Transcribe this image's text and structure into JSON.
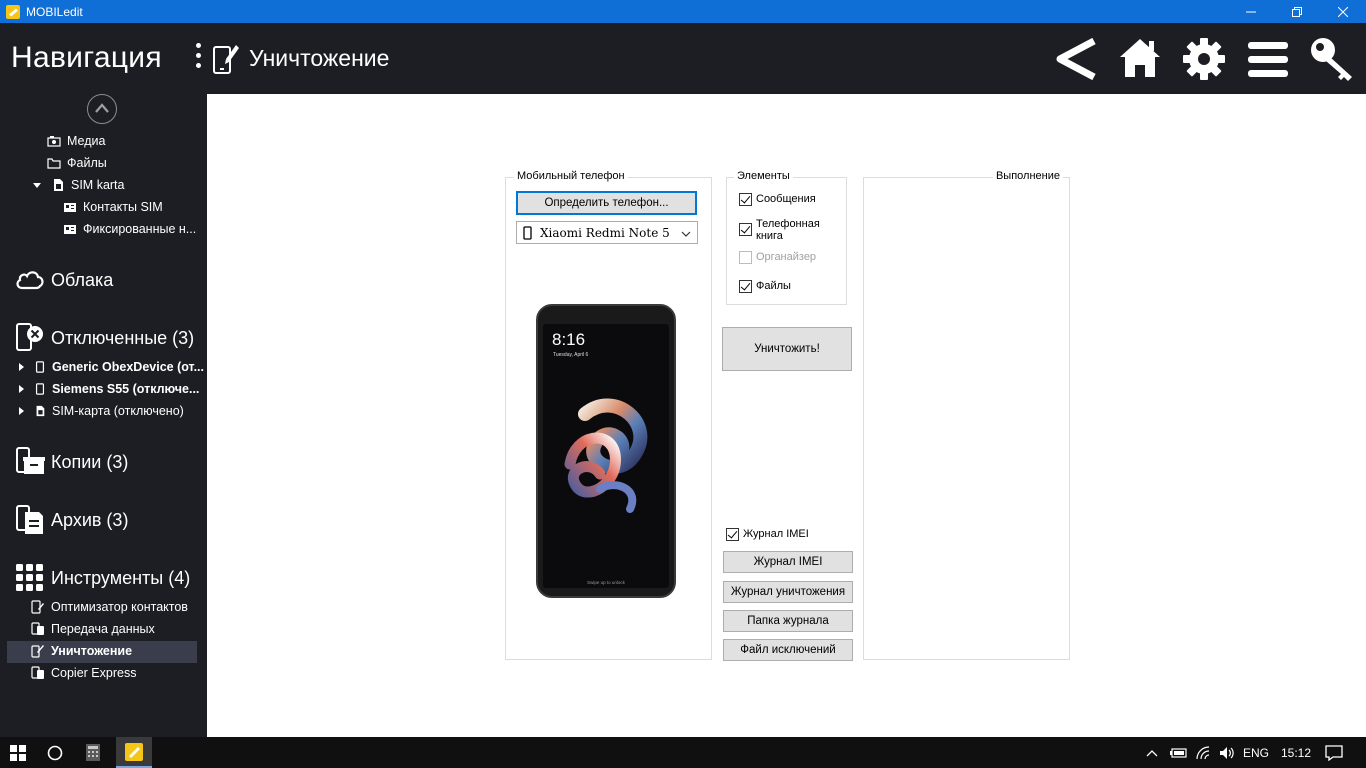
{
  "window": {
    "title": "MOBILedit",
    "controls": [
      "minimize",
      "restore",
      "close"
    ]
  },
  "header": {
    "nav_title": "Навигация",
    "page_title": "Уничтожение",
    "icons": [
      "back-icon",
      "home-icon",
      "gear-icon",
      "menu-icon",
      "key-icon"
    ]
  },
  "sidebar": {
    "phone_items": [
      {
        "label": "Медиа",
        "icon": "media-icon"
      },
      {
        "label": "Файлы",
        "icon": "folder-icon"
      },
      {
        "label": "SIM karta",
        "icon": "sim-icon"
      },
      {
        "label": "Контакты SIM",
        "icon": "contacts-icon"
      },
      {
        "label": "Фиксированные н...",
        "icon": "contacts-icon"
      }
    ],
    "clouds": {
      "label": "Облака",
      "icon": "cloud-icon"
    },
    "disconnected": {
      "label": "Отключенные (3)",
      "icon": "phone-disconnected-icon",
      "items": [
        {
          "label": "Generic ObexDevice (от...",
          "bold": true
        },
        {
          "label": "Siemens S55 (отключе...",
          "bold": true
        },
        {
          "label": "SIM-карта (отключено)",
          "bold": false
        }
      ]
    },
    "copies": {
      "label": "Копии (3)",
      "icon": "backup-icon"
    },
    "archive": {
      "label": "Архив (3)",
      "icon": "archive-icon"
    },
    "tools": {
      "label": "Инструменты (4)",
      "icon": "grid-icon",
      "items": [
        {
          "label": "Оптимизатор контактов"
        },
        {
          "label": "Передача данных"
        },
        {
          "label": "Уничтожение",
          "selected": true
        },
        {
          "label": "Copier Express"
        }
      ]
    }
  },
  "main": {
    "phone_group": {
      "label": "Мобильный телефон",
      "detect_button": "Определить телефон...",
      "selected_phone": "Xiaomi Redmi Note 5",
      "phone_screen_time": "8:16",
      "phone_screen_date": "Tuesday, April 6",
      "phone_screen_hint": "Swipe up to unlock"
    },
    "elements_group": {
      "label": "Элементы",
      "items": [
        {
          "label": "Сообщения",
          "checked": true,
          "enabled": true
        },
        {
          "label": "Телефонная книга",
          "checked": true,
          "enabled": true
        },
        {
          "label": "Органайзер",
          "checked": false,
          "enabled": false
        },
        {
          "label": "Файлы",
          "checked": true,
          "enabled": true
        }
      ]
    },
    "destroy_button": "Уничтожить!",
    "imei_log_checkbox": {
      "label": "Журнал IMEI",
      "checked": true
    },
    "log_buttons": [
      "Журнал IMEI",
      "Журнал уничтожения",
      "Папка журнала",
      "Файл исключений"
    ],
    "progress_group": {
      "label": "Выполнение"
    }
  },
  "taskbar": {
    "language": "ENG",
    "time": "15:12"
  }
}
